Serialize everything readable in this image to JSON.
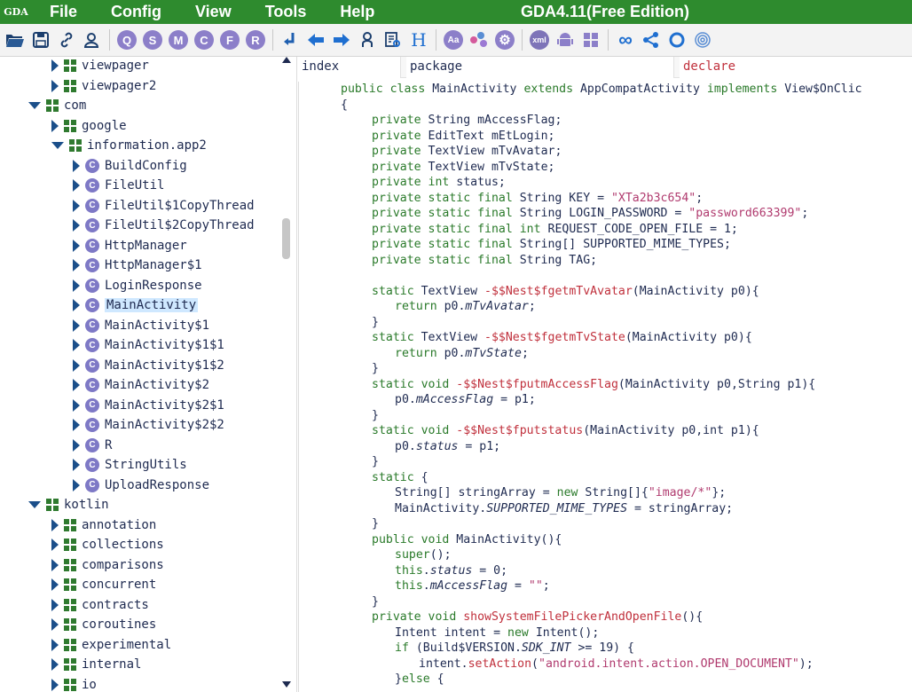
{
  "menubar": {
    "logo": "GDA",
    "items": [
      "File",
      "Config",
      "View",
      "Tools",
      "Help"
    ],
    "title": "GDA4.11(Free Edition)"
  },
  "toolbar": {
    "circle_buttons": [
      "Q",
      "S",
      "M",
      "C",
      "F",
      "R"
    ],
    "extra_buttons": [
      "Aa",
      "xml"
    ],
    "h_label": "H"
  },
  "colors": {
    "menubar": "#2e8b2e",
    "keyword": "#2a7a2a",
    "string": "#b03a6e",
    "method_name": "#c0303c",
    "class_icon": "#7e79c6"
  },
  "tree": {
    "rows": [
      {
        "label": "viewpager",
        "type": "package",
        "expanded": false,
        "level": 2
      },
      {
        "label": "viewpager2",
        "type": "package",
        "expanded": false,
        "level": 2
      },
      {
        "label": "com",
        "type": "package",
        "expanded": true,
        "level": 1
      },
      {
        "label": "google",
        "type": "package",
        "expanded": false,
        "level": 2
      },
      {
        "label": "information.app2",
        "type": "package",
        "expanded": true,
        "level": 2
      },
      {
        "label": "BuildConfig",
        "type": "class",
        "expanded": false,
        "level": 3
      },
      {
        "label": "FileUtil",
        "type": "class",
        "expanded": false,
        "level": 3
      },
      {
        "label": "FileUtil$1CopyThread",
        "type": "class",
        "expanded": false,
        "level": 3
      },
      {
        "label": "FileUtil$2CopyThread",
        "type": "class",
        "expanded": false,
        "level": 3
      },
      {
        "label": "HttpManager",
        "type": "class",
        "expanded": false,
        "level": 3
      },
      {
        "label": "HttpManager$1",
        "type": "class",
        "expanded": false,
        "level": 3
      },
      {
        "label": "LoginResponse",
        "type": "class",
        "expanded": false,
        "level": 3
      },
      {
        "label": "MainActivity",
        "type": "class",
        "expanded": false,
        "level": 3,
        "selected": true
      },
      {
        "label": "MainActivity$1",
        "type": "class",
        "expanded": false,
        "level": 3
      },
      {
        "label": "MainActivity$1$1",
        "type": "class",
        "expanded": false,
        "level": 3
      },
      {
        "label": "MainActivity$1$2",
        "type": "class",
        "expanded": false,
        "level": 3
      },
      {
        "label": "MainActivity$2",
        "type": "class",
        "expanded": false,
        "level": 3
      },
      {
        "label": "MainActivity$2$1",
        "type": "class",
        "expanded": false,
        "level": 3
      },
      {
        "label": "MainActivity$2$2",
        "type": "class",
        "expanded": false,
        "level": 3
      },
      {
        "label": "R",
        "type": "class",
        "expanded": false,
        "level": 3
      },
      {
        "label": "StringUtils",
        "type": "class",
        "expanded": false,
        "level": 3
      },
      {
        "label": "UploadResponse",
        "type": "class",
        "expanded": false,
        "level": 3
      },
      {
        "label": "kotlin",
        "type": "package",
        "expanded": true,
        "level": 1
      },
      {
        "label": "annotation",
        "type": "package",
        "expanded": false,
        "level": 2
      },
      {
        "label": "collections",
        "type": "package",
        "expanded": false,
        "level": 2
      },
      {
        "label": "comparisons",
        "type": "package",
        "expanded": false,
        "level": 2
      },
      {
        "label": "concurrent",
        "type": "package",
        "expanded": false,
        "level": 2
      },
      {
        "label": "contracts",
        "type": "package",
        "expanded": false,
        "level": 2
      },
      {
        "label": "coroutines",
        "type": "package",
        "expanded": false,
        "level": 2
      },
      {
        "label": "experimental",
        "type": "package",
        "expanded": false,
        "level": 2
      },
      {
        "label": "internal",
        "type": "package",
        "expanded": false,
        "level": 2
      },
      {
        "label": "io",
        "type": "package",
        "expanded": false,
        "level": 2
      }
    ]
  },
  "code_header": {
    "index": "index",
    "package": "package",
    "declare": "declare"
  },
  "code": {
    "lines": [
      {
        "indent": 0,
        "tokens": [
          [
            "kw",
            "public "
          ],
          [
            "kw",
            "class "
          ],
          [
            "t",
            "MainActivity "
          ],
          [
            "kw",
            "extends "
          ],
          [
            "t",
            "AppCompatActivity "
          ],
          [
            "kw",
            "implements "
          ],
          [
            "t",
            "View$OnClic"
          ]
        ]
      },
      {
        "indent": 0,
        "tokens": [
          [
            "t",
            "{"
          ]
        ]
      },
      {
        "indent": 1,
        "tokens": [
          [
            "kw",
            "private "
          ],
          [
            "t",
            "String mAccessFlag;"
          ]
        ]
      },
      {
        "indent": 1,
        "tokens": [
          [
            "kw",
            "private "
          ],
          [
            "t",
            "EditText mEtLogin;"
          ]
        ]
      },
      {
        "indent": 1,
        "tokens": [
          [
            "kw",
            "private "
          ],
          [
            "t",
            "TextView mTvAvatar;"
          ]
        ]
      },
      {
        "indent": 1,
        "tokens": [
          [
            "kw",
            "private "
          ],
          [
            "t",
            "TextView mTvState;"
          ]
        ]
      },
      {
        "indent": 1,
        "tokens": [
          [
            "kw",
            "private int "
          ],
          [
            "t",
            "status;"
          ]
        ]
      },
      {
        "indent": 1,
        "tokens": [
          [
            "kw",
            "private static final "
          ],
          [
            "t",
            "String KEY = "
          ],
          [
            "str",
            "\"XTa2b3c654\""
          ],
          [
            "t",
            ";"
          ]
        ]
      },
      {
        "indent": 1,
        "tokens": [
          [
            "kw",
            "private static final "
          ],
          [
            "t",
            "String LOGIN_PASSWORD = "
          ],
          [
            "str",
            "\"password663399\""
          ],
          [
            "t",
            ";"
          ]
        ]
      },
      {
        "indent": 1,
        "tokens": [
          [
            "kw",
            "private static final int "
          ],
          [
            "t",
            "REQUEST_CODE_OPEN_FILE = 1;"
          ]
        ]
      },
      {
        "indent": 1,
        "tokens": [
          [
            "kw",
            "private static final "
          ],
          [
            "t",
            "String[] SUPPORTED_MIME_TYPES;"
          ]
        ]
      },
      {
        "indent": 1,
        "tokens": [
          [
            "kw",
            "private static final "
          ],
          [
            "t",
            "String TAG;"
          ]
        ]
      },
      {
        "indent": 0,
        "tokens": [
          [
            "t",
            ""
          ]
        ]
      },
      {
        "indent": 1,
        "tokens": [
          [
            "kw",
            "static "
          ],
          [
            "t",
            "TextView "
          ],
          [
            "fn",
            "-$$Nest$fgetmTvAvatar"
          ],
          [
            "t",
            "(MainActivity p0){"
          ]
        ]
      },
      {
        "indent": 2,
        "tokens": [
          [
            "kw",
            "return "
          ],
          [
            "t",
            "p0."
          ],
          [
            "it",
            "mTvAvatar"
          ],
          [
            "t",
            ";"
          ]
        ]
      },
      {
        "indent": 1,
        "tokens": [
          [
            "t",
            "}"
          ]
        ]
      },
      {
        "indent": 1,
        "tokens": [
          [
            "kw",
            "static "
          ],
          [
            "t",
            "TextView "
          ],
          [
            "fn",
            "-$$Nest$fgetmTvState"
          ],
          [
            "t",
            "(MainActivity p0){"
          ]
        ]
      },
      {
        "indent": 2,
        "tokens": [
          [
            "kw",
            "return "
          ],
          [
            "t",
            "p0."
          ],
          [
            "it",
            "mTvState"
          ],
          [
            "t",
            ";"
          ]
        ]
      },
      {
        "indent": 1,
        "tokens": [
          [
            "t",
            "}"
          ]
        ]
      },
      {
        "indent": 1,
        "tokens": [
          [
            "kw",
            "static void "
          ],
          [
            "fn",
            "-$$Nest$fputmAccessFlag"
          ],
          [
            "t",
            "(MainActivity p0,String p1){"
          ]
        ]
      },
      {
        "indent": 2,
        "tokens": [
          [
            "t",
            "p0."
          ],
          [
            "it",
            "mAccessFlag"
          ],
          [
            "t",
            " = p1;"
          ]
        ]
      },
      {
        "indent": 1,
        "tokens": [
          [
            "t",
            "}"
          ]
        ]
      },
      {
        "indent": 1,
        "tokens": [
          [
            "kw",
            "static void "
          ],
          [
            "fn",
            "-$$Nest$fputstatus"
          ],
          [
            "t",
            "(MainActivity p0,int p1){"
          ]
        ]
      },
      {
        "indent": 2,
        "tokens": [
          [
            "t",
            "p0."
          ],
          [
            "it",
            "status"
          ],
          [
            "t",
            " = p1;"
          ]
        ]
      },
      {
        "indent": 1,
        "tokens": [
          [
            "t",
            "}"
          ]
        ]
      },
      {
        "indent": 1,
        "tokens": [
          [
            "kw",
            "static "
          ],
          [
            "t",
            "{"
          ]
        ]
      },
      {
        "indent": 2,
        "tokens": [
          [
            "t",
            "String[] stringArray = "
          ],
          [
            "kw",
            "new "
          ],
          [
            "t",
            "String[]{"
          ],
          [
            "str",
            "\"image/*\""
          ],
          [
            "t",
            "};"
          ]
        ]
      },
      {
        "indent": 2,
        "tokens": [
          [
            "t",
            "MainActivity."
          ],
          [
            "it",
            "SUPPORTED_MIME_TYPES"
          ],
          [
            "t",
            " = stringArray;"
          ]
        ]
      },
      {
        "indent": 1,
        "tokens": [
          [
            "t",
            "}"
          ]
        ]
      },
      {
        "indent": 1,
        "tokens": [
          [
            "kw",
            "public void "
          ],
          [
            "t",
            "MainActivity(){"
          ]
        ]
      },
      {
        "indent": 2,
        "tokens": [
          [
            "kw",
            "super"
          ],
          [
            "t",
            "();"
          ]
        ]
      },
      {
        "indent": 2,
        "tokens": [
          [
            "kw",
            "this"
          ],
          [
            "t",
            "."
          ],
          [
            "it",
            "status"
          ],
          [
            "t",
            " = 0;"
          ]
        ]
      },
      {
        "indent": 2,
        "tokens": [
          [
            "kw",
            "this"
          ],
          [
            "t",
            "."
          ],
          [
            "it",
            "mAccessFlag"
          ],
          [
            "t",
            " = "
          ],
          [
            "str",
            "\"\""
          ],
          [
            "t",
            ";"
          ]
        ]
      },
      {
        "indent": 1,
        "tokens": [
          [
            "t",
            "}"
          ]
        ]
      },
      {
        "indent": 1,
        "tokens": [
          [
            "kw",
            "private void "
          ],
          [
            "fn",
            "showSystemFilePickerAndOpenFile"
          ],
          [
            "t",
            "(){"
          ]
        ]
      },
      {
        "indent": 2,
        "tokens": [
          [
            "t",
            "Intent intent = "
          ],
          [
            "kw",
            "new "
          ],
          [
            "t",
            "Intent();"
          ]
        ]
      },
      {
        "indent": 2,
        "tokens": [
          [
            "kw",
            "if "
          ],
          [
            "t",
            "(Build$VERSION."
          ],
          [
            "it",
            "SDK_INT"
          ],
          [
            "t",
            " >= 19) {"
          ]
        ]
      },
      {
        "indent": 3,
        "tokens": [
          [
            "t",
            "intent."
          ],
          [
            "fn",
            "setAction"
          ],
          [
            "t",
            "("
          ],
          [
            "str",
            "\"android.intent.action.OPEN_DOCUMENT\""
          ],
          [
            "t",
            ");"
          ]
        ]
      },
      {
        "indent": 2,
        "tokens": [
          [
            "t",
            "}"
          ],
          [
            "kw",
            "else "
          ],
          [
            "t",
            "{"
          ]
        ]
      }
    ]
  }
}
